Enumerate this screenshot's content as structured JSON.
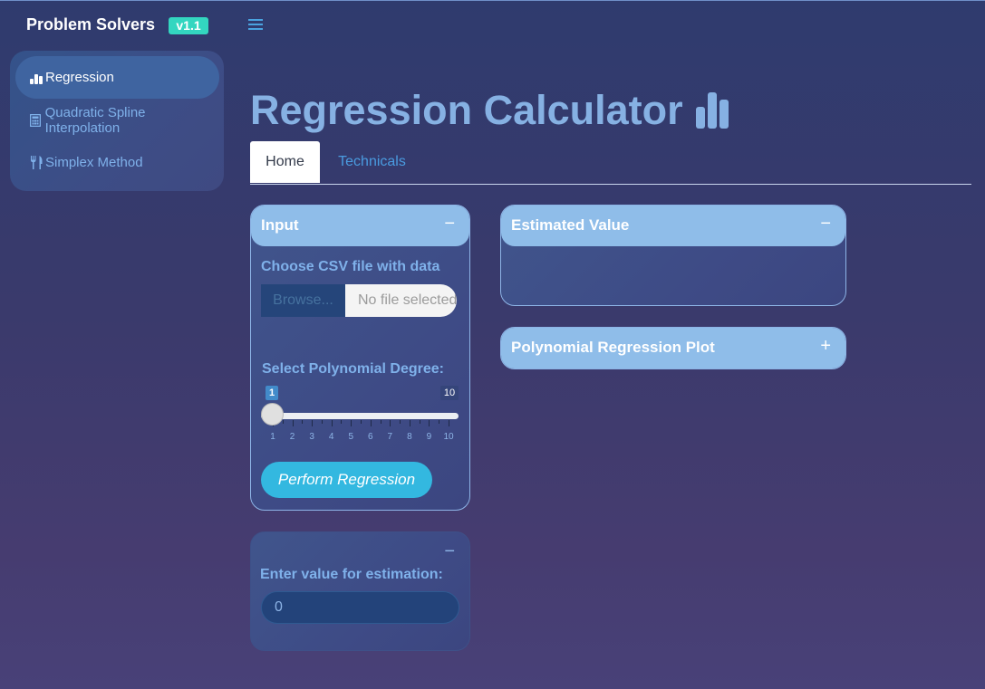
{
  "header": {
    "brand": "Problem Solvers",
    "version_badge": "v1.1",
    "menu_toggle_icon": "hamburger-icon"
  },
  "sidebar": {
    "items": [
      {
        "label": "Regression",
        "icon": "bar-chart-icon",
        "active": true
      },
      {
        "label": "Quadratic Spline Interpolation",
        "icon": "calculator-icon",
        "active": false
      },
      {
        "label": "Simplex Method",
        "icon": "utensils-icon",
        "active": false
      }
    ]
  },
  "main": {
    "title": "Regression Calculator",
    "title_icon": "bar-chart-icon",
    "tabs": [
      {
        "label": "Home",
        "active": true
      },
      {
        "label": "Technicals",
        "active": false
      }
    ]
  },
  "input_box": {
    "title": "Input",
    "collapse_symbol": "−",
    "file_label": "Choose CSV file with data",
    "browse_label": "Browse...",
    "file_placeholder": "No file selected",
    "degree_label": "Select Polynomial Degree:",
    "slider": {
      "min": 1,
      "max": 10,
      "value": 1,
      "ticks": [
        "1",
        "2",
        "3",
        "4",
        "5",
        "6",
        "7",
        "8",
        "9",
        "10"
      ],
      "min_text": "1",
      "max_text": "10"
    },
    "button_label": "Perform Regression"
  },
  "estimation_box": {
    "collapse_symbol": "−",
    "label": "Enter value for estimation:",
    "value": "0"
  },
  "estimated_value_box": {
    "title": "Estimated Value",
    "collapse_symbol": "−"
  },
  "plot_box": {
    "title": "Polynomial Regression Plot",
    "expand_symbol": "+"
  },
  "colors": {
    "accent": "#8fbde9",
    "badge": "#33d6c0",
    "button": "#33b8e0"
  }
}
